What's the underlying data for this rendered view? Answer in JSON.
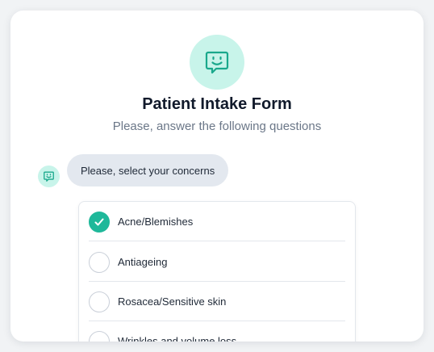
{
  "form": {
    "title": "Patient Intake Form",
    "subtitle": "Please, answer the following questions",
    "icon": "smiley-chat-icon"
  },
  "chat": {
    "avatar_icon": "smiley-chat-icon",
    "question": "Please, select your concerns"
  },
  "options": [
    {
      "label": "Acne/Blemishes",
      "checked": true
    },
    {
      "label": "Antiageing",
      "checked": false
    },
    {
      "label": "Rosacea/Sensitive skin",
      "checked": false
    },
    {
      "label": "Wrinkles and volume loss",
      "checked": false
    }
  ],
  "colors": {
    "accent": "#1fb89a",
    "accent_light": "#c8f4ea",
    "bubble": "#e3e8ef",
    "title": "#111a2b",
    "subtitle": "#6b7788"
  }
}
